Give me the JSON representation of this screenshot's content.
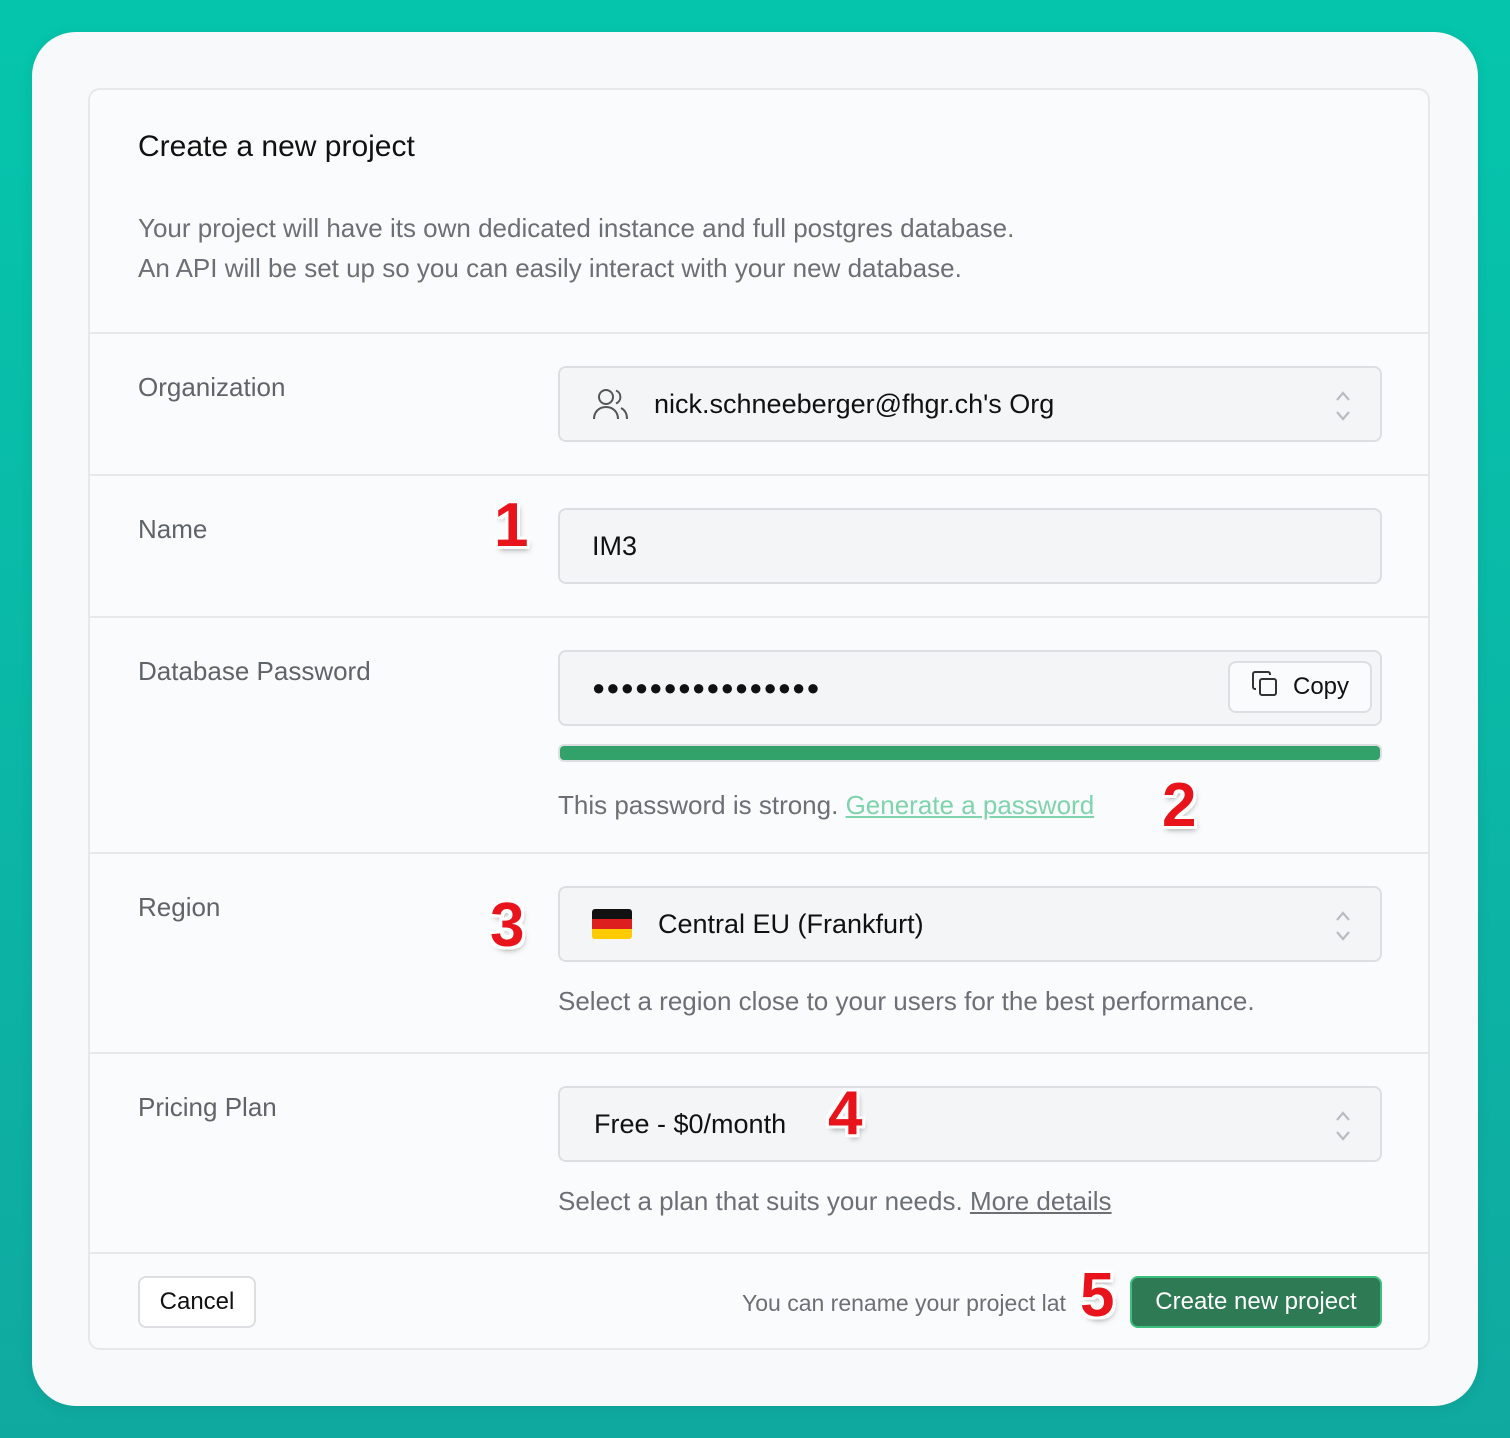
{
  "header": {
    "title": "Create a new project",
    "description_line1": "Your project will have its own dedicated instance and full postgres database.",
    "description_line2": "An API will be set up so you can easily interact with your new database."
  },
  "organization": {
    "label": "Organization",
    "value": "nick.schneeberger@fhgr.ch's Org",
    "icon": "users-icon"
  },
  "name": {
    "label": "Name",
    "value": "IM3"
  },
  "password": {
    "label": "Database Password",
    "masked_value": "●●●●●●●●●●●●●●●●",
    "copy_label": "Copy",
    "strength": 1.0,
    "strength_color": "#33a26a",
    "hint_text": "This password is strong.",
    "generate_link": "Generate a password"
  },
  "region": {
    "label": "Region",
    "value": "Central EU (Frankfurt)",
    "flag": "germany-flag-icon",
    "hint": "Select a region close to your users for the best performance."
  },
  "pricing": {
    "label": "Pricing Plan",
    "value": "Free - $0/month",
    "hint": "Select a plan that suits your needs.",
    "details_link": "More details"
  },
  "footer": {
    "cancel_label": "Cancel",
    "note": "You can rename your project lat",
    "create_label": "Create new project"
  },
  "annotations": [
    "1",
    "2",
    "3",
    "4",
    "5"
  ],
  "colors": {
    "accent": "#2d7a54",
    "link_green": "#7fd3ad",
    "marker_red": "#e8131b",
    "background": "#05c6ad"
  }
}
